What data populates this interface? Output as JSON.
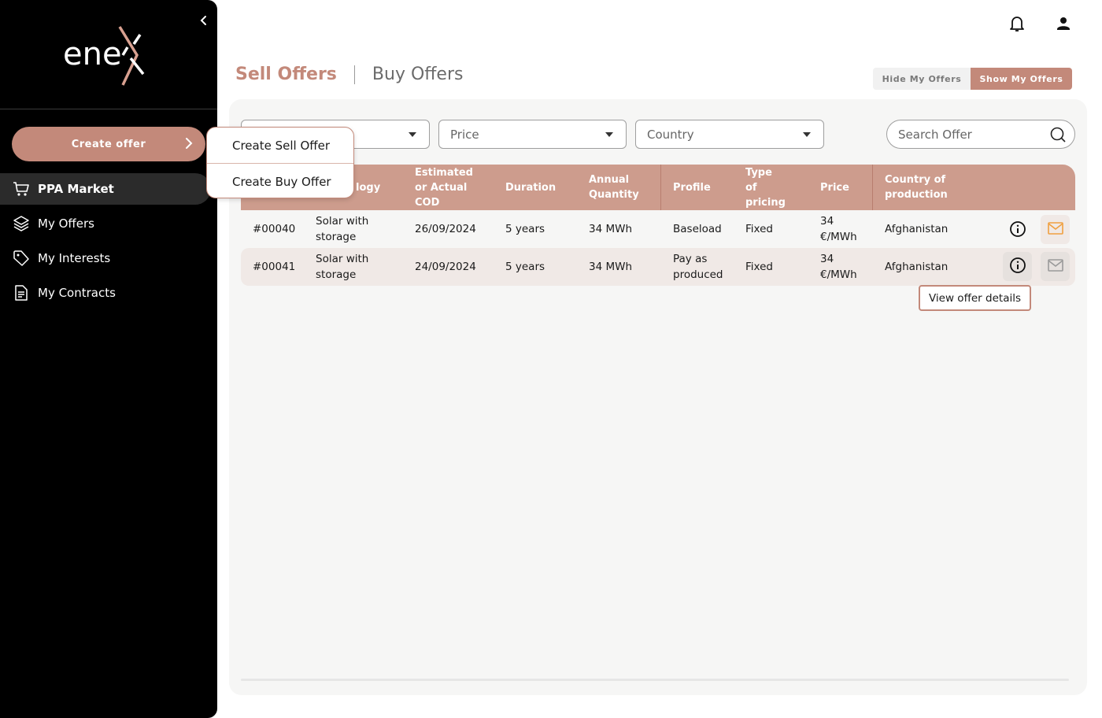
{
  "sidebar": {
    "logo_text": "enex",
    "create_button": "Create offer",
    "nav": [
      {
        "label": "PPA Market",
        "icon": "cart-icon",
        "active": true
      },
      {
        "label": "My Offers",
        "icon": "layers-icon",
        "active": false
      },
      {
        "label": "My Interests",
        "icon": "tag-icon",
        "active": false
      },
      {
        "label": "My Contracts",
        "icon": "document-icon",
        "active": false
      }
    ]
  },
  "header": {
    "icons": [
      "bell-icon",
      "user-icon"
    ]
  },
  "tabs": {
    "sell": "Sell Offers",
    "buy": "Buy Offers"
  },
  "toggle": {
    "hide": "Hide My Offers",
    "show": "Show My Offers"
  },
  "filters": {
    "price": "Price",
    "country": "Country",
    "search_placeholder": "Search Offer"
  },
  "dropdown": {
    "sell": "Create Sell Offer",
    "buy": "Create Buy Offer"
  },
  "table": {
    "headers": {
      "technology_fragment": "logy",
      "cod": [
        "Estimated",
        "or Actual",
        "COD"
      ],
      "duration": "Duration",
      "quantity": [
        "Annual",
        "Quantity"
      ],
      "profile": "Profile",
      "pricing": [
        "Type",
        "of",
        "pricing"
      ],
      "price": "Price",
      "country": [
        "Country of",
        "production"
      ]
    },
    "rows": [
      {
        "id": "#00040",
        "technology": [
          "Solar with",
          "storage"
        ],
        "cod": "26/09/2024",
        "duration": "5 years",
        "quantity": "34 MWh",
        "profile": [
          "Baseload"
        ],
        "pricing": "Fixed",
        "price": [
          "34",
          "€/MWh"
        ],
        "country": "Afghanistan"
      },
      {
        "id": "#00041",
        "technology": [
          "Solar with",
          "storage"
        ],
        "cod": "24/09/2024",
        "duration": "5 years",
        "quantity": "34 MWh",
        "profile": [
          "Pay as",
          "produced"
        ],
        "pricing": "Fixed",
        "price": [
          "34",
          "€/MWh"
        ],
        "country": "Afghanistan"
      }
    ]
  },
  "tooltip": "View offer details",
  "colors": {
    "accent": "#c3897a",
    "header_bg": "#cd9c8d",
    "mail_active": "#f0a040"
  }
}
